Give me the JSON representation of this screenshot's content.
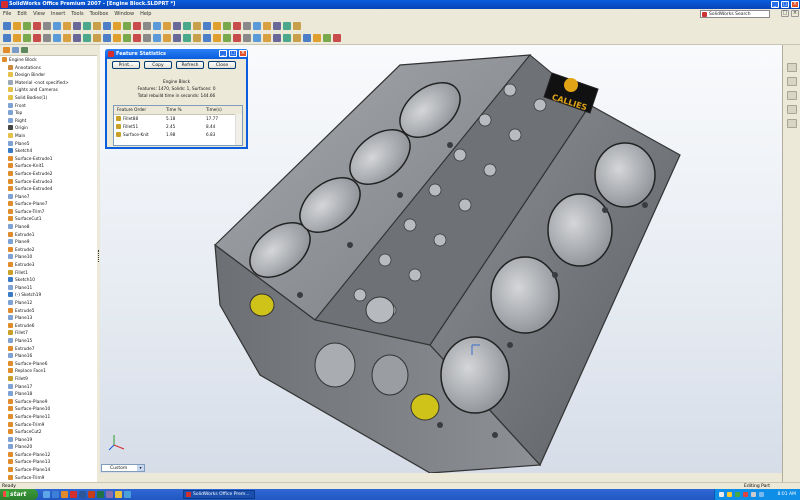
{
  "window": {
    "title": "SolidWorks Office Premium 2007 - [Engine Block.SLDPRT *]",
    "min_icon": "minimize-icon",
    "max_icon": "maximize-icon",
    "close_icon": "close-icon"
  },
  "menu": {
    "items": [
      "File",
      "Edit",
      "View",
      "Insert",
      "Tools",
      "Toolbox",
      "Window",
      "Help"
    ]
  },
  "search": {
    "label": "SolidWorks Search"
  },
  "feature_tree": {
    "items": [
      {
        "label": "Engine Block",
        "icon": "part"
      },
      {
        "label": "Annotations",
        "icon": "annotation"
      },
      {
        "label": "Design Binder",
        "icon": "folder"
      },
      {
        "label": "Material <not specified>",
        "icon": "body"
      },
      {
        "label": "Lights and Cameras",
        "icon": "folder"
      },
      {
        "label": "Solid Bodies(1)",
        "icon": "folder"
      },
      {
        "label": "Front",
        "icon": "plane"
      },
      {
        "label": "Top",
        "icon": "plane"
      },
      {
        "label": "Right",
        "icon": "plane"
      },
      {
        "label": "Origin",
        "icon": "point"
      },
      {
        "label": "Main",
        "icon": "folder"
      },
      {
        "label": "Plane5",
        "icon": "plane"
      },
      {
        "label": "Sketch4",
        "icon": "sketch"
      },
      {
        "label": "Surface-Extrude1",
        "icon": "feature"
      },
      {
        "label": "Surface-Knit1",
        "icon": "feature"
      },
      {
        "label": "Surface-Extrude2",
        "icon": "feature"
      },
      {
        "label": "Surface-Extrude3",
        "icon": "feature"
      },
      {
        "label": "Surface-Extrude4",
        "icon": "feature"
      },
      {
        "label": "Plane7",
        "icon": "plane"
      },
      {
        "label": "Surface-Plane7",
        "icon": "feature"
      },
      {
        "label": "Surface-Trim7",
        "icon": "feature"
      },
      {
        "label": "SurfaceCut1",
        "icon": "feature"
      },
      {
        "label": "Plane8",
        "icon": "plane"
      },
      {
        "label": "Extrude1",
        "icon": "feature"
      },
      {
        "label": "Plane9",
        "icon": "plane"
      },
      {
        "label": "Extrude2",
        "icon": "feature"
      },
      {
        "label": "Plane10",
        "icon": "plane"
      },
      {
        "label": "Extrude3",
        "icon": "feature"
      },
      {
        "label": "Fillet1",
        "icon": "fillet"
      },
      {
        "label": "Sketch10",
        "icon": "sketch"
      },
      {
        "label": "Plane11",
        "icon": "plane"
      },
      {
        "label": "(-) Sketch19",
        "icon": "sketch"
      },
      {
        "label": "Plane12",
        "icon": "plane"
      },
      {
        "label": "Extrude5",
        "icon": "feature"
      },
      {
        "label": "Plane13",
        "icon": "plane"
      },
      {
        "label": "Extrude6",
        "icon": "feature"
      },
      {
        "label": "Fillet7",
        "icon": "fillet"
      },
      {
        "label": "Plane15",
        "icon": "plane"
      },
      {
        "label": "Extrude7",
        "icon": "feature"
      },
      {
        "label": "Plane16",
        "icon": "plane"
      },
      {
        "label": "Surface-Plane6",
        "icon": "feature"
      },
      {
        "label": "Replace Face1",
        "icon": "feature"
      },
      {
        "label": "Fillet9",
        "icon": "fillet"
      },
      {
        "label": "Plane17",
        "icon": "plane"
      },
      {
        "label": "Plane18",
        "icon": "plane"
      },
      {
        "label": "Surface-Plane9",
        "icon": "feature"
      },
      {
        "label": "Surface-Plane10",
        "icon": "feature"
      },
      {
        "label": "Surface-Plane11",
        "icon": "feature"
      },
      {
        "label": "Surface-Trim9",
        "icon": "feature"
      },
      {
        "label": "SurfaceCut2",
        "icon": "feature"
      },
      {
        "label": "Plane19",
        "icon": "plane"
      },
      {
        "label": "Plane20",
        "icon": "plane"
      },
      {
        "label": "Surface-Plane12",
        "icon": "feature"
      },
      {
        "label": "Surface-Plane13",
        "icon": "feature"
      },
      {
        "label": "Surface-Plane14",
        "icon": "feature"
      },
      {
        "label": "Surface-Trim9",
        "icon": "feature"
      }
    ]
  },
  "dialog": {
    "title": "Feature Statistics",
    "buttons": [
      "Print...",
      "Copy",
      "Refresh",
      "Close"
    ],
    "part_name": "Engine Block",
    "summary": "Features: 1470, Solids: 1, Surfaces: 0",
    "rebuild_time": "Total rebuild time in seconds: 144.66",
    "columns": [
      "Feature Order",
      "Time %",
      "Time(s)"
    ],
    "rows": [
      {
        "name": "Fillet88",
        "pct": "5.18",
        "time": "17.77"
      },
      {
        "name": "Fillet51",
        "pct": "2.45",
        "time": "8.44"
      },
      {
        "name": "Surface-Knit",
        "pct": "1.98",
        "time": "6.83"
      }
    ]
  },
  "config": {
    "value": "Custom"
  },
  "status": {
    "left": "Ready",
    "right": "Editing Part"
  },
  "taskbar": {
    "start": "start",
    "task": "SolidWorks Office Prem...",
    "clock": "8:01 AM"
  },
  "logo": {
    "text": "CALLIES"
  },
  "colors": {
    "title_blue": "#0a5ddc",
    "xp_bg": "#ece9d8",
    "start_green": "#3c9a3c",
    "part_metal": "#8a8d92"
  }
}
